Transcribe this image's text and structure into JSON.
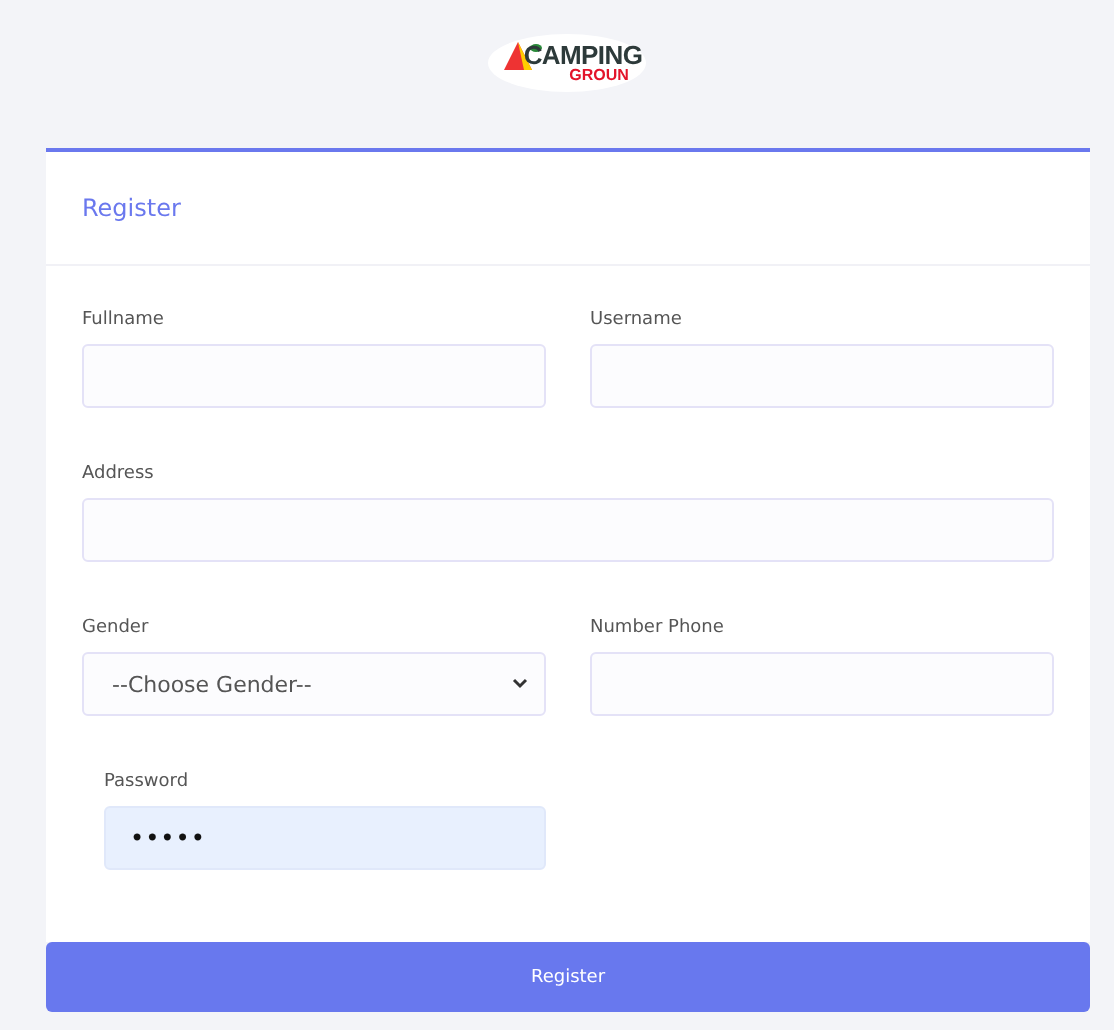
{
  "logo": {
    "line1": "CAMPING",
    "line2": "GROUN"
  },
  "card": {
    "title": "Register"
  },
  "fields": [
    {
      "kind": "text",
      "label": "Fullname",
      "span": false
    },
    {
      "kind": "text",
      "label": "Username",
      "span": false
    },
    {
      "kind": "text",
      "label": "Address",
      "span": true
    },
    {
      "kind": "select",
      "label": "Gender",
      "value": "--Choose Gender--",
      "span": false
    },
    {
      "kind": "text",
      "label": "Number Phone",
      "span": false
    },
    {
      "kind": "password",
      "label": "Password",
      "value": "•••••",
      "span": false
    }
  ],
  "submit": {
    "label": "Register"
  }
}
